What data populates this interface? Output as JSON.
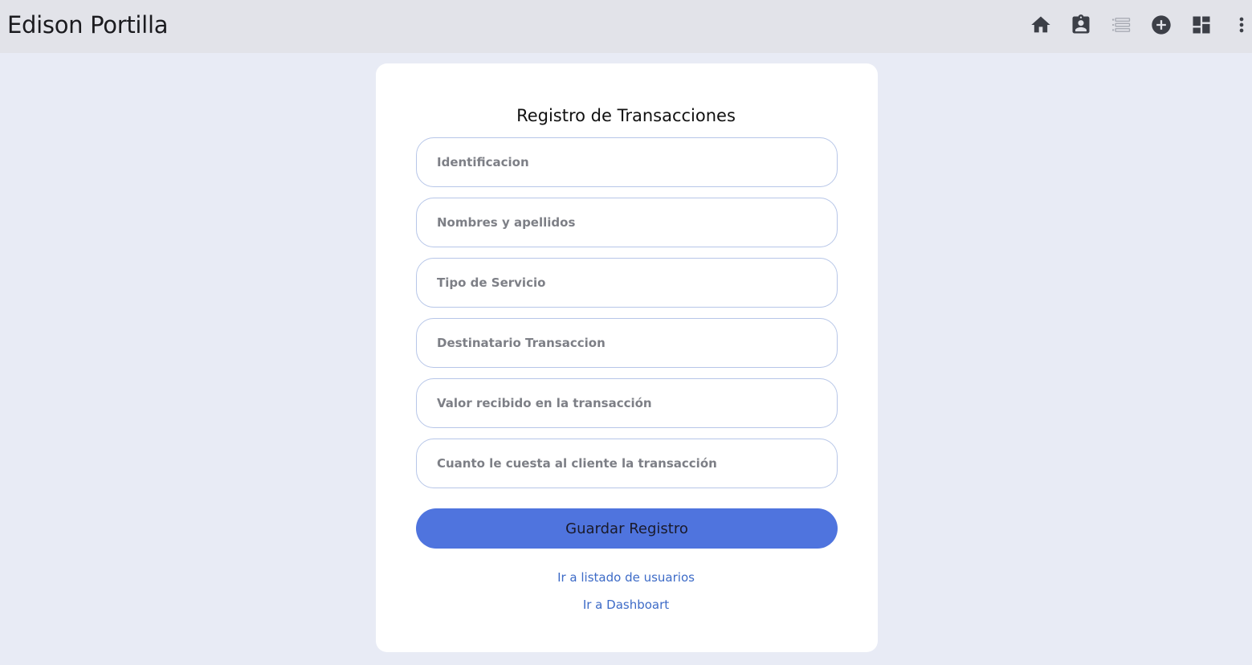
{
  "header": {
    "title": "Edison Portilla",
    "icons": [
      "home-icon",
      "contact-badge-icon",
      "list-icon",
      "add-circle-icon",
      "dashboard-icon",
      "more-vert-icon"
    ]
  },
  "form": {
    "title": "Registro de Transacciones",
    "fields": [
      {
        "placeholder": "Identificacion"
      },
      {
        "placeholder": "Nombres y apellidos"
      },
      {
        "placeholder": "Tipo de Servicio"
      },
      {
        "placeholder": "Destinatario Transaccion"
      },
      {
        "placeholder": "Valor recibido en la transacción"
      },
      {
        "placeholder": "Cuanto le cuesta al cliente la transacción"
      }
    ],
    "submit_label": "Guardar Registro"
  },
  "links": {
    "users": "Ir a listado de usuarios",
    "dashboard": "Ir a Dashboart"
  },
  "colors": {
    "topbar": "#e2e3e9",
    "background": "#e8ebf5",
    "button": "#4f74de",
    "link": "#3d6bc7",
    "field_border": "#b7c6e8"
  }
}
